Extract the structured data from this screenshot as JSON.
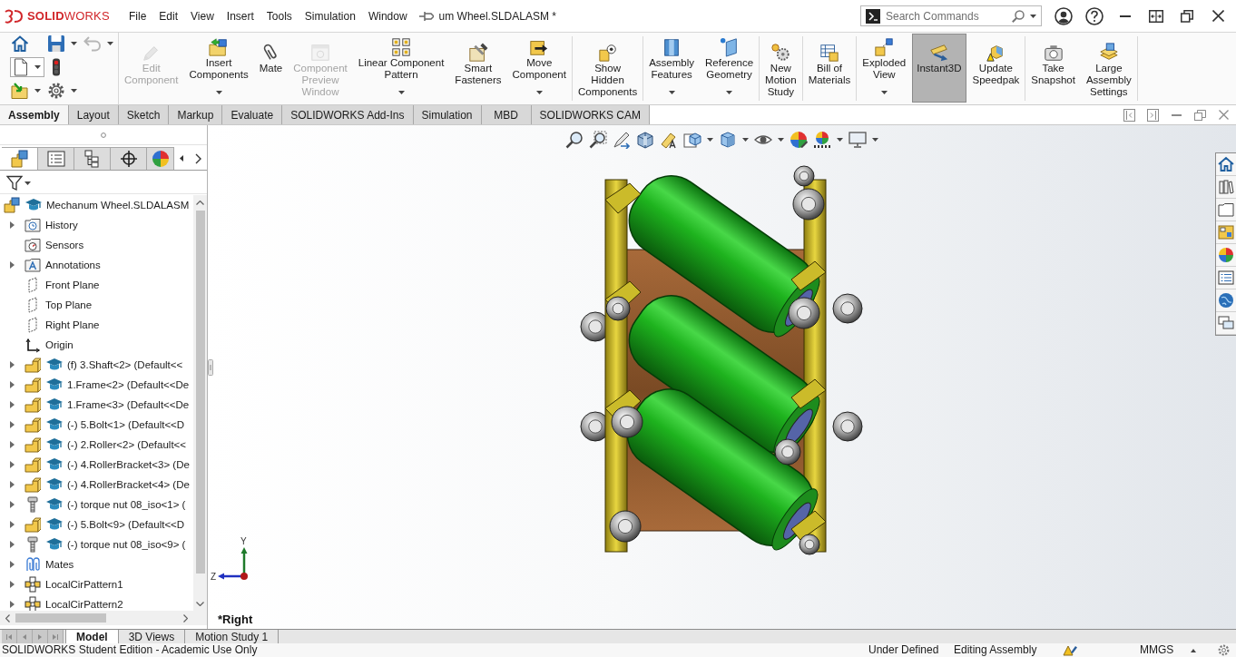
{
  "title_bar": {
    "logo": "**SOLID**WORKS",
    "menus": [
      "File",
      "Edit",
      "View",
      "Insert",
      "Tools",
      "Simulation",
      "Window"
    ],
    "document_title": "um Wheel.SLDALASM *",
    "search": {
      "placeholder": "Search Commands"
    }
  },
  "ribbon": {
    "quick_access": [
      {
        "disabled": false,
        "dropdown": false
      },
      {
        "disabled": false,
        "dropdown": true
      },
      {
        "disabled": true,
        "dropdown": true
      },
      {
        "disabled": false,
        "dropdown": true
      },
      {
        "disabled": false,
        "dropdown": false
      },
      {
        "disabled": false,
        "dropdown": true
      },
      {
        "disabled": false,
        "dropdown": true
      }
    ],
    "groups": [
      [
        {
          "label": "Edit\nComponent",
          "disabled": true,
          "dropdown": false,
          "selected": false
        },
        {
          "label": "Insert\nComponents",
          "disabled": false,
          "dropdown": true,
          "selected": false
        },
        {
          "label": "Mate",
          "disabled": false,
          "dropdown": false,
          "selected": false
        },
        {
          "label": "Component\nPreview\nWindow",
          "disabled": true,
          "dropdown": false,
          "selected": false
        },
        {
          "label": "Linear Component\nPattern",
          "disabled": false,
          "dropdown": true,
          "selected": false
        },
        {
          "label": "Smart\nFasteners",
          "disabled": false,
          "dropdown": false,
          "selected": false
        },
        {
          "label": "Move\nComponent",
          "disabled": false,
          "dropdown": true,
          "selected": false
        }
      ],
      [
        {
          "label": "Show\nHidden\nComponents",
          "disabled": false,
          "dropdown": false,
          "selected": false
        }
      ],
      [
        {
          "label": "Assembly\nFeatures",
          "disabled": false,
          "dropdown": true,
          "selected": false
        },
        {
          "label": "Reference\nGeometry",
          "disabled": false,
          "dropdown": true,
          "selected": false
        }
      ],
      [
        {
          "label": "New\nMotion\nStudy",
          "disabled": false,
          "dropdown": false,
          "selected": false
        }
      ],
      [
        {
          "label": "Bill of\nMaterials",
          "disabled": false,
          "dropdown": false,
          "selected": false
        }
      ],
      [
        {
          "label": "Exploded\nView",
          "disabled": false,
          "dropdown": true,
          "selected": false
        },
        {
          "label": "Instant3D",
          "disabled": false,
          "dropdown": false,
          "selected": true
        },
        {
          "label": "Update\nSpeedpak",
          "disabled": false,
          "dropdown": false,
          "selected": false
        }
      ],
      [
        {
          "label": "Take\nSnapshot",
          "disabled": false,
          "dropdown": false,
          "selected": false
        },
        {
          "label": "Large\nAssembly\nSettings",
          "disabled": false,
          "dropdown": false,
          "selected": false
        }
      ]
    ]
  },
  "command_tabs": [
    {
      "label": "Assembly",
      "selected": true
    },
    {
      "label": "Layout",
      "selected": false
    },
    {
      "label": "Sketch",
      "selected": false
    },
    {
      "label": "Markup",
      "selected": false
    },
    {
      "label": "Evaluate",
      "selected": false
    },
    {
      "label": "SOLIDWORKS Add-Ins",
      "selected": false
    },
    {
      "label": "Simulation",
      "selected": false
    },
    {
      "label": "MBD",
      "selected": false
    },
    {
      "label": "SOLIDWORKS CAM",
      "selected": false
    }
  ],
  "feature_manager": {
    "panel_tabs": [
      {
        "selected": true
      },
      {
        "selected": false
      },
      {
        "selected": false
      },
      {
        "selected": false
      },
      {
        "selected": false
      }
    ],
    "tree": [
      {
        "label": "Mechanum Wheel.SLDALASM",
        "kind": "assembly",
        "expandable": false,
        "children": [
          {
            "label": "History",
            "kind": "history",
            "expandable": true
          },
          {
            "label": "Sensors",
            "kind": "sensors",
            "expandable": false
          },
          {
            "label": "Annotations",
            "kind": "annotations",
            "expandable": true
          },
          {
            "label": "Front Plane",
            "kind": "plane",
            "expandable": false
          },
          {
            "label": "Top Plane",
            "kind": "plane",
            "expandable": false
          },
          {
            "label": "Right Plane",
            "kind": "plane",
            "expandable": false
          },
          {
            "label": "Origin",
            "kind": "origin",
            "expandable": false
          },
          {
            "label": "(f) 3.Shaft<2> (Default<<",
            "kind": "part",
            "expandable": true
          },
          {
            "label": "1.Frame<2> (Default<<De",
            "kind": "part",
            "expandable": true
          },
          {
            "label": "1.Frame<3> (Default<<De",
            "kind": "part",
            "expandable": true
          },
          {
            "label": "(-) 5.Bolt<1> (Default<<D",
            "kind": "part",
            "expandable": true
          },
          {
            "label": "(-) 2.Roller<2> (Default<<",
            "kind": "part",
            "expandable": true
          },
          {
            "label": "(-) 4.RollerBracket<3> (De",
            "kind": "part",
            "expandable": true
          },
          {
            "label": "(-) 4.RollerBracket<4> (De",
            "kind": "part",
            "expandable": true
          },
          {
            "label": "(-) torque nut 08_iso<1> (",
            "kind": "toolbox",
            "expandable": true
          },
          {
            "label": "(-) 5.Bolt<9> (Default<<D",
            "kind": "part",
            "expandable": true
          },
          {
            "label": "(-) torque nut 08_iso<9> (",
            "kind": "toolbox",
            "expandable": true
          },
          {
            "label": "Mates",
            "kind": "mates",
            "expandable": true
          },
          {
            "label": "LocalCirPattern1",
            "kind": "pattern",
            "expandable": true
          },
          {
            "label": "LocalCirPattern2",
            "kind": "pattern",
            "expandable": true
          }
        ]
      }
    ]
  },
  "viewport": {
    "triad": {
      "y_label": "Y",
      "z_label": "Z"
    },
    "view_name": "*Right"
  },
  "bottom_tabs": [
    {
      "label": "Model",
      "selected": true
    },
    {
      "label": "3D Views",
      "selected": false
    },
    {
      "label": "Motion Study 1",
      "selected": false
    }
  ],
  "status_bar": {
    "edition": "SOLIDWORKS Student Edition - Academic Use Only",
    "definition": "Under Defined",
    "mode": "Editing Assembly",
    "units": "MMGS"
  }
}
